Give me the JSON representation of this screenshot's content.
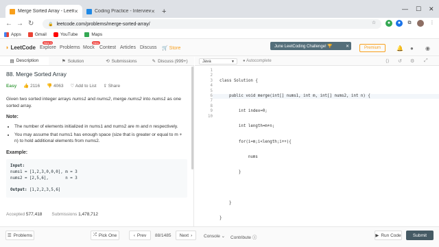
{
  "browser": {
    "tabs": [
      {
        "title": "Merge Sorted Array - LeetCode",
        "active": true
      },
      {
        "title": "Coding Practice - InterviewBit",
        "active": false
      }
    ],
    "url": "leetcode.com/problems/merge-sorted-array/",
    "bookmarks": [
      "Apps",
      "Gmail",
      "YouTube",
      "Maps"
    ]
  },
  "nav": {
    "logo": "LeetCode",
    "links": [
      "Explore",
      "Problems",
      "Mock",
      "Contest",
      "Articles",
      "Discuss",
      "Store"
    ],
    "explore_badge": "New 3",
    "mock_badge": "New",
    "promo": "June LeetCoding Challenge! 🏆",
    "premium": "Premium"
  },
  "left": {
    "tabs": [
      "Description",
      "Solution",
      "Submissions",
      "Discuss (999+)"
    ],
    "title": "88. Merge Sorted Array",
    "difficulty": "Easy",
    "likes": "2116",
    "dislikes": "4063",
    "add_to_list": "Add to List",
    "share": "Share",
    "desc_prefix": "Given two sorted integer arrays ",
    "desc_nums1": "nums1",
    "desc_and": " and ",
    "desc_nums2": "nums2",
    "desc_mid": ", merge ",
    "desc_nums2b": "nums2",
    "desc_into": " into ",
    "desc_nums1b": "nums1",
    "desc_suffix": " as one sorted array.",
    "note_label": "Note:",
    "notes": [
      "The number of elements initialized in nums1 and nums2 are m and n respectively.",
      "You may assume that nums1 has enough space (size that is greater or equal to m + n) to hold additional elements from nums2."
    ],
    "example_label": "Example:",
    "example_input_label": "Input:",
    "example_line1": "nums1 = [1,2,3,0,0,0], m = 3",
    "example_line2": "nums2 = [2,5,6],       n = 3",
    "example_output_label": "Output:",
    "example_output": " [1,2,2,3,5,6]",
    "accepted_label": "Accepted",
    "accepted": "577,418",
    "submissions_label": "Submissions",
    "submissions": "1,478,712"
  },
  "editor": {
    "language": "Java",
    "autocomplete": "Autocomplete",
    "line_numbers": [
      "1",
      "2",
      "3",
      "4",
      "5",
      "6",
      "7",
      "8",
      "9",
      "10"
    ],
    "code_lines": [
      "class Solution {",
      "    public void merge(int[] nums1, int m, int[] nums2, int n) {",
      "        int index=0;",
      "        int length=m+n;",
      "        for(i=m;i<length;i++){",
      "            nums",
      "        }",
      "",
      "    }",
      "}"
    ]
  },
  "bottom": {
    "problems": "Problems",
    "pick_one": "Pick One",
    "prev": "Prev",
    "page": "88/1485",
    "next": "Next",
    "console": "Console",
    "contribute": "Contribute",
    "run_code": "Run Code",
    "submit": "Submit"
  }
}
